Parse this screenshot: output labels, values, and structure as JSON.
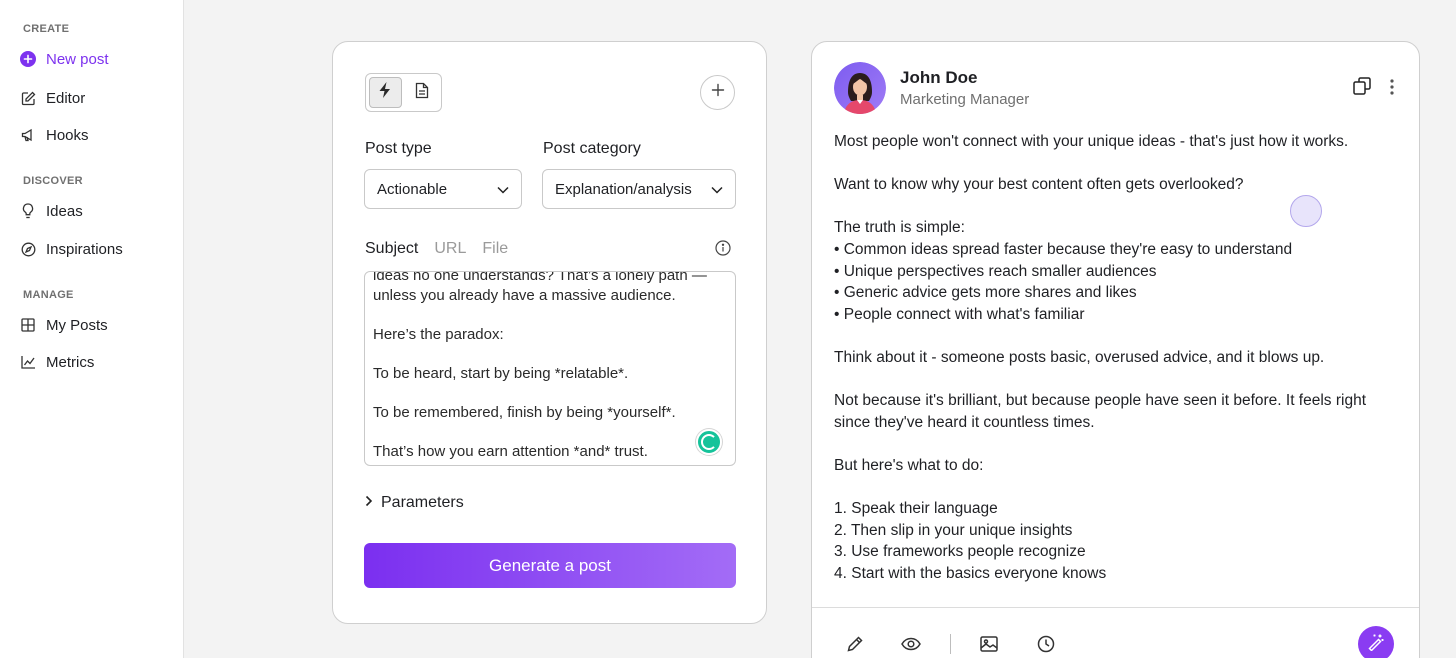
{
  "sidebar": {
    "sections": [
      {
        "label": "CREATE",
        "items": [
          {
            "label": "New post",
            "icon": "plus-circle-icon",
            "active": true
          },
          {
            "label": "Editor",
            "icon": "edit-icon"
          },
          {
            "label": "Hooks",
            "icon": "megaphone-icon"
          }
        ]
      },
      {
        "label": "DISCOVER",
        "items": [
          {
            "label": "Ideas",
            "icon": "lightbulb-icon"
          },
          {
            "label": "Inspirations",
            "icon": "compass-icon"
          }
        ]
      },
      {
        "label": "MANAGE",
        "items": [
          {
            "label": "My Posts",
            "icon": "grid-icon"
          },
          {
            "label": "Metrics",
            "icon": "chart-icon"
          }
        ]
      }
    ]
  },
  "generator": {
    "post_type_label": "Post type",
    "post_type_value": "Actionable",
    "post_category_label": "Post category",
    "post_category_value": "Explanation/analysis",
    "tabs": [
      "Subject",
      "URL",
      "File"
    ],
    "subject_text": [
      "ideas no one understands? That’s a lonely path — unless you already have a massive audience.",
      "",
      "Here’s the paradox:",
      "",
      "To be heard, start by being *relatable*.",
      "",
      "To be remembered, finish by being *yourself*.",
      "",
      "That’s how you earn attention *and* trust."
    ],
    "parameters_label": "Parameters",
    "generate_label": "Generate a post"
  },
  "preview": {
    "author_name": "John Doe",
    "author_role": "Marketing Manager",
    "post_lines": [
      "Most people won't connect with your unique ideas - that's just how it works.",
      "",
      "Want to know why your best content often gets overlooked?",
      "",
      "The truth is simple:",
      "• Common ideas spread faster because they're easy to understand",
      "• Unique perspectives reach smaller audiences",
      "• Generic advice gets more shares and likes",
      "• People connect with what's familiar",
      "",
      "Think about it - someone posts basic, overused advice, and it blows up.",
      "",
      "Not because it's brilliant, but because people have seen it before. It feels right",
      "since they've heard it countless times.",
      "",
      "But here's what to do:",
      "",
      "1. Speak their language",
      "2. Then slip in your unique insights",
      "3. Use frameworks people recognize",
      "4. Start with the basics everyone knows"
    ]
  },
  "colors": {
    "accent": "#7d32ef",
    "button_gradient_start": "#7b2ff0",
    "button_gradient_end": "#a36cf6"
  }
}
